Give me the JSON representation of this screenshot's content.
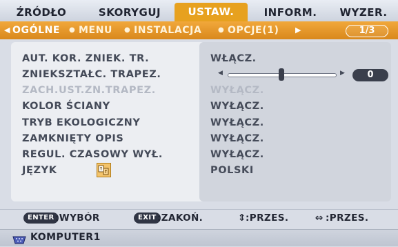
{
  "tabs": [
    {
      "label": "ŹRÓDŁO",
      "active": false
    },
    {
      "label": "SKORYGUJ",
      "active": false
    },
    {
      "label": "USTAW.",
      "active": true
    },
    {
      "label": "INFORM.",
      "active": false
    },
    {
      "label": "WYZER.",
      "active": false
    }
  ],
  "subtabs": {
    "items": [
      {
        "label": "OGÓLNE",
        "active": true
      },
      {
        "label": "MENU",
        "active": false
      },
      {
        "label": "INSTALACJA",
        "active": false
      },
      {
        "label": "OPCJE(1)",
        "active": false
      }
    ],
    "page": "1/3"
  },
  "settings": [
    {
      "label": "AUT. KOR. ZNIEK. TR.",
      "value": "WŁĄCZ.",
      "disabled": false
    },
    {
      "label": "ZNIEKSZTAŁC. TRAPEZ.",
      "value": "0",
      "disabled": false,
      "control": "slider",
      "level": 0.5
    },
    {
      "label": "ZACH.UST.ZN.TRAPEZ.",
      "value": "WYŁĄCZ.",
      "disabled": true
    },
    {
      "label": "KOLOR ŚCIANY",
      "value": "WYŁĄCZ.",
      "disabled": false
    },
    {
      "label": "TRYB EKOLOGICZNY",
      "value": "WYŁĄCZ.",
      "disabled": false
    },
    {
      "label": "ZAMKNIĘTY OPIS",
      "value": "WYŁĄCZ.",
      "disabled": false
    },
    {
      "label": "REGUL. CZASOWY WYŁ.",
      "value": "WYŁĄCZ.",
      "disabled": false
    },
    {
      "label": "JĘZYK",
      "value": "POLSKI",
      "disabled": false,
      "icon": "language-icon"
    }
  ],
  "hints": [
    {
      "key": "ENTER",
      "text": ":WYBÓR"
    },
    {
      "key": "EXIT",
      "text": ":ZAKOŃ."
    },
    {
      "key": "⇕",
      "text": ":PRZES."
    },
    {
      "key": "⇔",
      "text": ":PRZES."
    }
  ],
  "footer": {
    "source": "KOMPUTER1",
    "icon": "computer-input-icon"
  },
  "colors": {
    "accent": "#e7a11f",
    "subbar": "#e3931e",
    "panel": "#eceef2",
    "value_panel": "#d1d5dd"
  }
}
